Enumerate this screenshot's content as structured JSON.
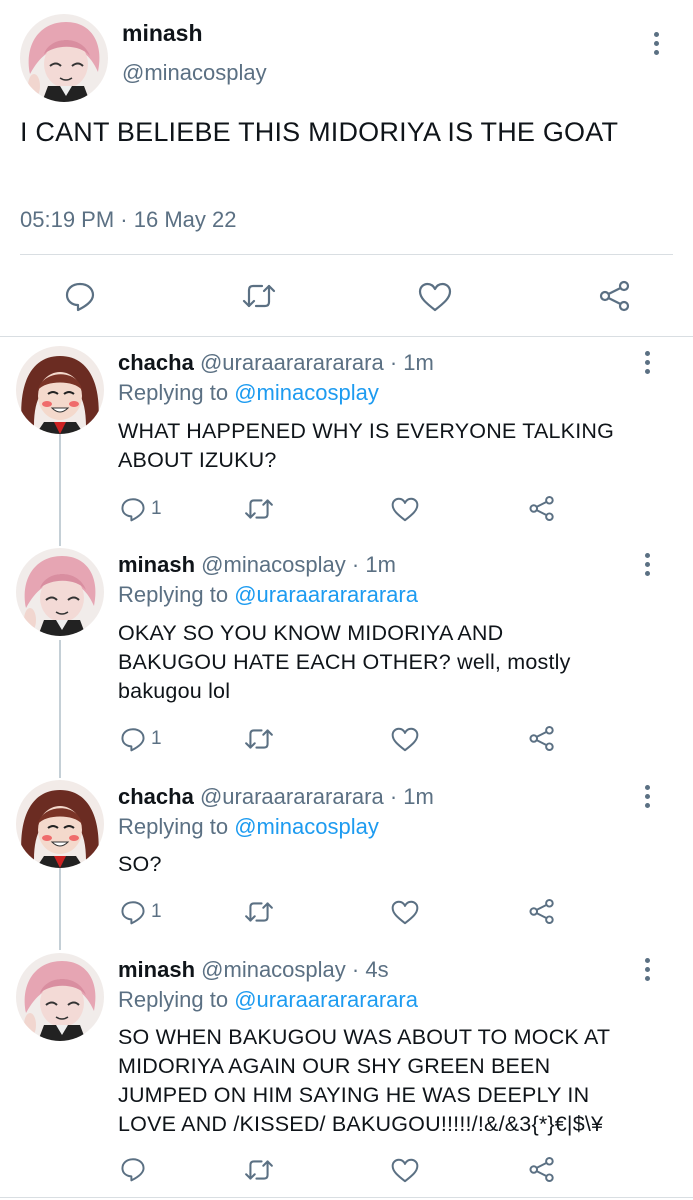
{
  "main_tweet": {
    "name": "minash",
    "handle": "@minacosplay",
    "text": "I CANT BELIEBE THIS MIDORIYA IS THE GOAT",
    "time": "05:19 PM",
    "date": "16 May 22",
    "separator": "·"
  },
  "replies": [
    {
      "name": "chacha",
      "handle": "@uraraararararara",
      "time": "1m",
      "replying_prefix": "Replying to",
      "replying_to": "@minacosplay",
      "text_lines": [
        "WHAT HAPPENED WHY IS EVERYONE TALKING",
        "ABOUT IZUKU?"
      ],
      "reply_count": "1"
    },
    {
      "name": "minash",
      "handle": "@minacosplay",
      "time": "1m",
      "replying_prefix": "Replying to",
      "replying_to": "@uraraararararara",
      "text_lines": [
        "OKAY SO YOU KNOW MIDORIYA AND",
        "BAKUGOU HATE EACH OTHER? well, mostly",
        "bakugou lol"
      ],
      "reply_count": "1"
    },
    {
      "name": "chacha",
      "handle": "@uraraararararara",
      "time": "1m",
      "replying_prefix": "Replying to",
      "replying_to": "@minacosplay",
      "text_lines": [
        "SO?"
      ],
      "reply_count": "1"
    },
    {
      "name": "minash",
      "handle": "@minacosplay",
      "time": "4s",
      "replying_prefix": "Replying to",
      "replying_to": "@uraraararararara",
      "text_lines": [
        "SO WHEN BAKUGOU WAS ABOUT TO MOCK AT",
        "MIDORIYA AGAIN OUR SHY GREEN BEEN",
        "JUMPED ON HIM SAYING HE WAS DEEPLY IN",
        "LOVE AND /KISSED/ BAKUGOU!!!!!/!&/&3{*}€|$\\¥"
      ],
      "reply_count": ""
    }
  ],
  "icons": {
    "reply": "reply-icon",
    "retweet": "retweet-icon",
    "like": "heart-icon",
    "share": "share-icon",
    "more": "more-vertical-icon"
  },
  "colors": {
    "text": "#0f1419",
    "secondary": "#5b7083",
    "link": "#1d9bf0",
    "divider": "#d9dee2",
    "thread_line": "#c4cfd6"
  }
}
